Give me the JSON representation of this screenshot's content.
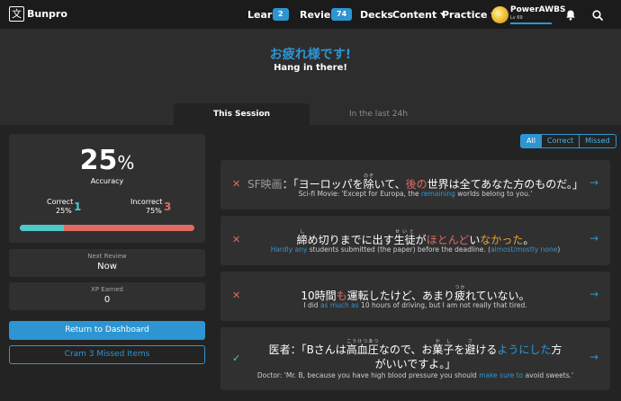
{
  "nav": {
    "brand": "Bunpro",
    "logo_glyph": "文",
    "learn_label": "Learn",
    "learn_count": "2",
    "review_label": "Review",
    "review_count": "74",
    "decks_label": "Decks",
    "content_label": "Content",
    "practice_label": "Practice",
    "username": "PowerAWBS",
    "level": "Lv 69",
    "xp_fraction": 1.0,
    "icons": [
      "bell-icon",
      "search-icon"
    ]
  },
  "hero": {
    "title": "お疲れ様です!",
    "subtitle": "Hang in there!",
    "tabs": [
      "This Session",
      "In the last 24h"
    ]
  },
  "stats": {
    "accuracy_value": "25",
    "accuracy_unit": "%",
    "accuracy_label": "Accuracy",
    "correct_label": "Correct",
    "correct_pct": "25%",
    "correct_count": "1",
    "incorrect_label": "Incorrect",
    "incorrect_pct": "75%",
    "incorrect_count": "3",
    "correct_fraction": 0.25,
    "next_review_label": "Next Review",
    "next_review_value": "Now",
    "xp_label": "XP Earned",
    "xp_value": "0"
  },
  "buttons": {
    "return": "Return to Dashboard",
    "cram": "Cram 3 Missed Items"
  },
  "filters": [
    "All",
    "Correct",
    "Missed"
  ],
  "items": [
    {
      "status": "incorrect",
      "mark": "✕",
      "jp": [
        {
          "text": "SF映画",
          "cls": "c-grey"
        },
        {
          "text": "：「ヨーロッパを"
        },
        {
          "text": "除",
          "ruby": "のぞ"
        },
        {
          "text": "いて、"
        },
        {
          "text": "後の",
          "cls": "c-red"
        },
        {
          "text": "世界は全てあなた方のものだ。」"
        }
      ],
      "en": [
        {
          "text": "Sci-fi Movie: 'Except for Europa, the "
        },
        {
          "text": "remaining",
          "cls": "c-blue"
        },
        {
          "text": " worlds belong to you.'"
        }
      ]
    },
    {
      "status": "incorrect",
      "mark": "✕",
      "jp": [
        {
          "text": "締",
          "ruby": "し"
        },
        {
          "text": "め切りまでに出す"
        },
        {
          "text": "生徒",
          "ruby": "せいと"
        },
        {
          "text": "が"
        },
        {
          "text": "ほとんど",
          "cls": "c-red"
        },
        {
          "text": "い"
        },
        {
          "text": "なかった",
          "cls": "c-orange"
        },
        {
          "text": "。"
        }
      ],
      "en": [
        {
          "text": "Hardly any",
          "cls": "c-blue"
        },
        {
          "text": " students submitted (the paper) before the deadline. ("
        },
        {
          "text": "almost/mostly none",
          "cls": "c-blue"
        },
        {
          "text": ")"
        }
      ]
    },
    {
      "status": "incorrect",
      "mark": "✕",
      "jp": [
        {
          "text": "10時間"
        },
        {
          "text": "も",
          "cls": "c-red"
        },
        {
          "text": "運転したけど、あまり"
        },
        {
          "text": "疲",
          "ruby": "つか"
        },
        {
          "text": "れていない。"
        }
      ],
      "en": [
        {
          "text": "I did "
        },
        {
          "text": "as much as",
          "cls": "c-blue"
        },
        {
          "text": " 10 hours of driving, but I am not really that tired."
        }
      ]
    },
    {
      "status": "correct",
      "mark": "✓",
      "jp": [
        {
          "text": "医者：「Bさんは"
        },
        {
          "text": "高血圧",
          "ruby": "こうけつあつ"
        },
        {
          "text": "なので、お"
        },
        {
          "text": "菓子",
          "ruby": "かし"
        },
        {
          "text": "を"
        },
        {
          "text": "避",
          "ruby": "さ"
        },
        {
          "text": "ける"
        },
        {
          "text": "ようにした",
          "cls": "c-blue"
        },
        {
          "text": "方がいいですよ。」"
        }
      ],
      "en": [
        {
          "text": "Doctor: 'Mr. B, because you have high blood pressure you should "
        },
        {
          "text": "make sure to",
          "cls": "c-blue"
        },
        {
          "text": " avoid sweets.'"
        }
      ]
    }
  ]
}
